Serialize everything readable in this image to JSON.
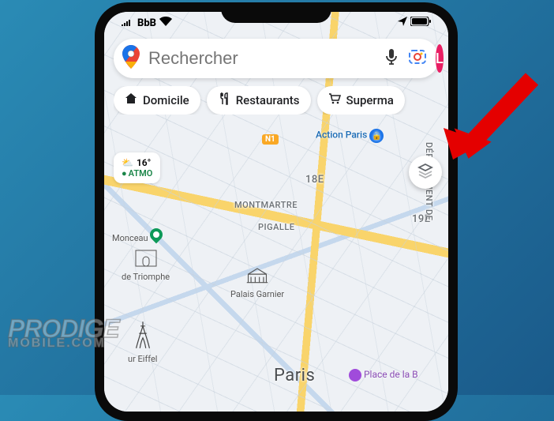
{
  "status": {
    "carrier": "BbB"
  },
  "search": {
    "placeholder": "Rechercher"
  },
  "avatar": {
    "initial": "L"
  },
  "chips": [
    {
      "icon": "home",
      "label": "Domicile"
    },
    {
      "icon": "restaurant",
      "label": "Restaurants"
    },
    {
      "icon": "cart",
      "label": "Superma"
    }
  ],
  "weather": {
    "temp": "16°",
    "air": "ATMO"
  },
  "labels": {
    "montmartre": "MONTMARTRE",
    "pigalle": "PIGALLE",
    "paris": "Paris",
    "dept": "DÉPARTEMENT DE",
    "d18e": "18E",
    "d19e": "19E"
  },
  "poi": {
    "action": "Action Paris",
    "monceau": "Monceau",
    "triomphe": "de Triomphe",
    "garnier": "Palais Garnier",
    "eiffel": "ur Eiffel",
    "place": "Place de la B"
  },
  "watermark": {
    "line1": "PRODIGE",
    "line2": "MOBILE.COM"
  }
}
